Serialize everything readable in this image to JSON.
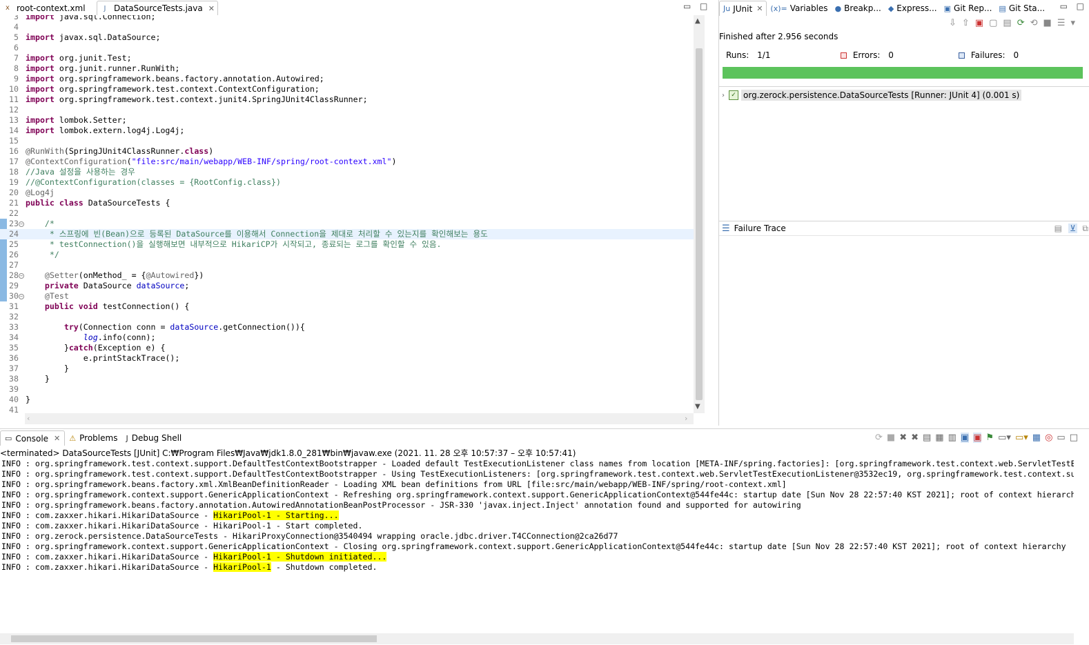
{
  "editor": {
    "tabs": [
      {
        "label": "root-context.xml",
        "active": false
      },
      {
        "label": "DataSourceTests.java",
        "active": true
      }
    ],
    "lines": [
      {
        "n": "3",
        "html": "<span class=\"kw\">import</span> java.sql.Connection;"
      },
      {
        "n": "4",
        "html": ""
      },
      {
        "n": "5",
        "html": "<span class=\"kw\">import</span> javax.sql.DataSource;"
      },
      {
        "n": "6",
        "html": ""
      },
      {
        "n": "7",
        "html": "<span class=\"kw\">import</span> org.junit.Test;"
      },
      {
        "n": "8",
        "html": "<span class=\"kw\">import</span> org.junit.runner.RunWith;"
      },
      {
        "n": "9",
        "html": "<span class=\"kw\">import</span> org.springframework.beans.factory.annotation.Autowired;"
      },
      {
        "n": "10",
        "html": "<span class=\"kw\">import</span> org.springframework.test.context.ContextConfiguration;"
      },
      {
        "n": "11",
        "html": "<span class=\"kw\">import</span> org.springframework.test.context.junit4.SpringJUnit4ClassRunner;"
      },
      {
        "n": "12",
        "html": ""
      },
      {
        "n": "13",
        "html": "<span class=\"kw\">import</span> lombok.Setter;"
      },
      {
        "n": "14",
        "html": "<span class=\"kw\">import</span> lombok.extern.log4j.Log4j;"
      },
      {
        "n": "15",
        "html": ""
      },
      {
        "n": "16",
        "html": "<span class=\"an\">@RunWith</span>(SpringJUnit4ClassRunner.<span class=\"kw\">class</span>)"
      },
      {
        "n": "17",
        "html": "<span class=\"an\">@ContextConfiguration</span>(<span class=\"str\">\"file:src/main/webapp/WEB-INF/spring/root-context.xml\"</span>)"
      },
      {
        "n": "18",
        "html": "<span class=\"cm\">//Java 설정을 사용하는 경우</span>"
      },
      {
        "n": "19",
        "html": "<span class=\"cm\">//@ContextConfiguration(classes = {RootConfig.class})</span>"
      },
      {
        "n": "20",
        "html": "<span class=\"an\">@Log4j</span>"
      },
      {
        "n": "21",
        "html": "<span class=\"kw\">public</span> <span class=\"kw\">class</span> DataSourceTests {"
      },
      {
        "n": "22",
        "html": ""
      },
      {
        "n": "23",
        "html": "    <span class=\"cm\">/*</span>",
        "fold": true
      },
      {
        "n": "24",
        "html": "<span class=\"cm\">     * 스프링에 빈(Bean)으로 등록된 DataSource를 이용해서 Connection을 제대로 처리할 수 있는지를 확인해보는 용도</span>",
        "hl": true
      },
      {
        "n": "25",
        "html": "<span class=\"cm\">     * testConnection()을 실행해보면 내부적으로 HikariCP가 시작되고, 종료되는 로그를 확인할 수 있음.</span>"
      },
      {
        "n": "26",
        "html": "<span class=\"cm\">     */</span>"
      },
      {
        "n": "27",
        "html": ""
      },
      {
        "n": "28",
        "html": "    <span class=\"an\">@Setter</span>(onMethod_ = {<span class=\"an\">@Autowired</span>})",
        "fold": true
      },
      {
        "n": "29",
        "html": "    <span class=\"kw\">private</span> DataSource <span class=\"fld\">dataSource</span>;"
      },
      {
        "n": "30",
        "html": "    <span class=\"an\">@Test</span>",
        "fold": true
      },
      {
        "n": "31",
        "html": "    <span class=\"kw\">public</span> <span class=\"kw\">void</span> testConnection() {"
      },
      {
        "n": "32",
        "html": ""
      },
      {
        "n": "33",
        "html": "        <span class=\"kw\">try</span>(Connection conn = <span class=\"fld\">dataSource</span>.getConnection()){"
      },
      {
        "n": "34",
        "html": "            <span class=\"fld it\">log</span>.info(conn);"
      },
      {
        "n": "35",
        "html": "        }<span class=\"kw\">catch</span>(Exception e) {"
      },
      {
        "n": "36",
        "html": "            e.printStackTrace();"
      },
      {
        "n": "37",
        "html": "        }"
      },
      {
        "n": "38",
        "html": "    }"
      },
      {
        "n": "39",
        "html": ""
      },
      {
        "n": "40",
        "html": "}"
      },
      {
        "n": "41",
        "html": ""
      }
    ]
  },
  "junit": {
    "tabs": [
      {
        "label": "JUnit",
        "icon": "Ju",
        "active": true
      },
      {
        "label": "Variables",
        "icon": "(x)=",
        "active": false
      },
      {
        "label": "Breakp...",
        "icon": "●",
        "active": false
      },
      {
        "label": "Express...",
        "icon": "◆",
        "active": false
      },
      {
        "label": "Git Rep...",
        "icon": "▣",
        "active": false
      },
      {
        "label": "Git Sta...",
        "icon": "▤",
        "active": false
      }
    ],
    "finished": "Finished after 2.956 seconds",
    "runs_label": "Runs:",
    "runs_value": "1/1",
    "errors_label": "Errors:",
    "errors_value": "0",
    "failures_label": "Failures:",
    "failures_value": "0",
    "progress": 1.0,
    "progress_color": "#5cc35c",
    "tree_item": "org.zerock.persistence.DataSourceTests [Runner: JUnit 4] (0.001 s)",
    "failure_trace_title": "Failure Trace"
  },
  "console": {
    "tabs": [
      {
        "label": "Console",
        "icon": "▭",
        "active": true
      },
      {
        "label": "Problems",
        "icon": "⚠",
        "active": false
      },
      {
        "label": "Debug Shell",
        "icon": "J",
        "active": false
      }
    ],
    "status": "<terminated> DataSourceTests [JUnit] C:₩Program Files₩Java₩jdk1.8.0_281₩bin₩javaw.exe  (2021. 11. 28 오후 10:57:37 – 오후 10:57:41)",
    "lines": [
      {
        "pre": "INFO : org.springframework.test.context.support.DefaultTestContextBootstrapper - Loaded default TestExecutionListener class names from location [META-INF/spring.factories]: [org.springframework.test.context.web.ServletTestEx",
        "hi": "",
        "post": ""
      },
      {
        "pre": "INFO : org.springframework.test.context.support.DefaultTestContextBootstrapper - Using TestExecutionListeners: [org.springframework.test.context.web.ServletTestExecutionListener@3532ec19, org.springframework.test.context.sup",
        "hi": "",
        "post": ""
      },
      {
        "pre": "INFO : org.springframework.beans.factory.xml.XmlBeanDefinitionReader - Loading XML bean definitions from URL [file:src/main/webapp/WEB-INF/spring/root-context.xml]",
        "hi": "",
        "post": ""
      },
      {
        "pre": "INFO : org.springframework.context.support.GenericApplicationContext - Refreshing org.springframework.context.support.GenericApplicationContext@544fe44c: startup date [Sun Nov 28 22:57:40 KST 2021]; root of context hierarchy",
        "hi": "",
        "post": ""
      },
      {
        "pre": "INFO : org.springframework.beans.factory.annotation.AutowiredAnnotationBeanPostProcessor - JSR-330 'javax.inject.Inject' annotation found and supported for autowiring",
        "hi": "",
        "post": ""
      },
      {
        "pre": "INFO : com.zaxxer.hikari.HikariDataSource - ",
        "hi": "HikariPool-1 - Starting...",
        "post": ""
      },
      {
        "pre": "INFO : com.zaxxer.hikari.HikariDataSource - HikariPool-1 - Start completed.",
        "hi": "",
        "post": ""
      },
      {
        "pre": "INFO : org.zerock.persistence.DataSourceTests - HikariProxyConnection@3540494 wrapping oracle.jdbc.driver.T4CConnection@2ca26d77",
        "hi": "",
        "post": ""
      },
      {
        "pre": "INFO : org.springframework.context.support.GenericApplicationContext - Closing org.springframework.context.support.GenericApplicationContext@544fe44c: startup date [Sun Nov 28 22:57:40 KST 2021]; root of context hierarchy",
        "hi": "",
        "post": ""
      },
      {
        "pre": "INFO : com.zaxxer.hikari.HikariDataSource - ",
        "hi": "HikariPool-1 - Shutdown initiated...",
        "post": ""
      },
      {
        "pre": "INFO : com.zaxxer.hikari.HikariDataSource - ",
        "hi": "HikariPool-1",
        "post": " - Shutdown completed."
      }
    ]
  }
}
